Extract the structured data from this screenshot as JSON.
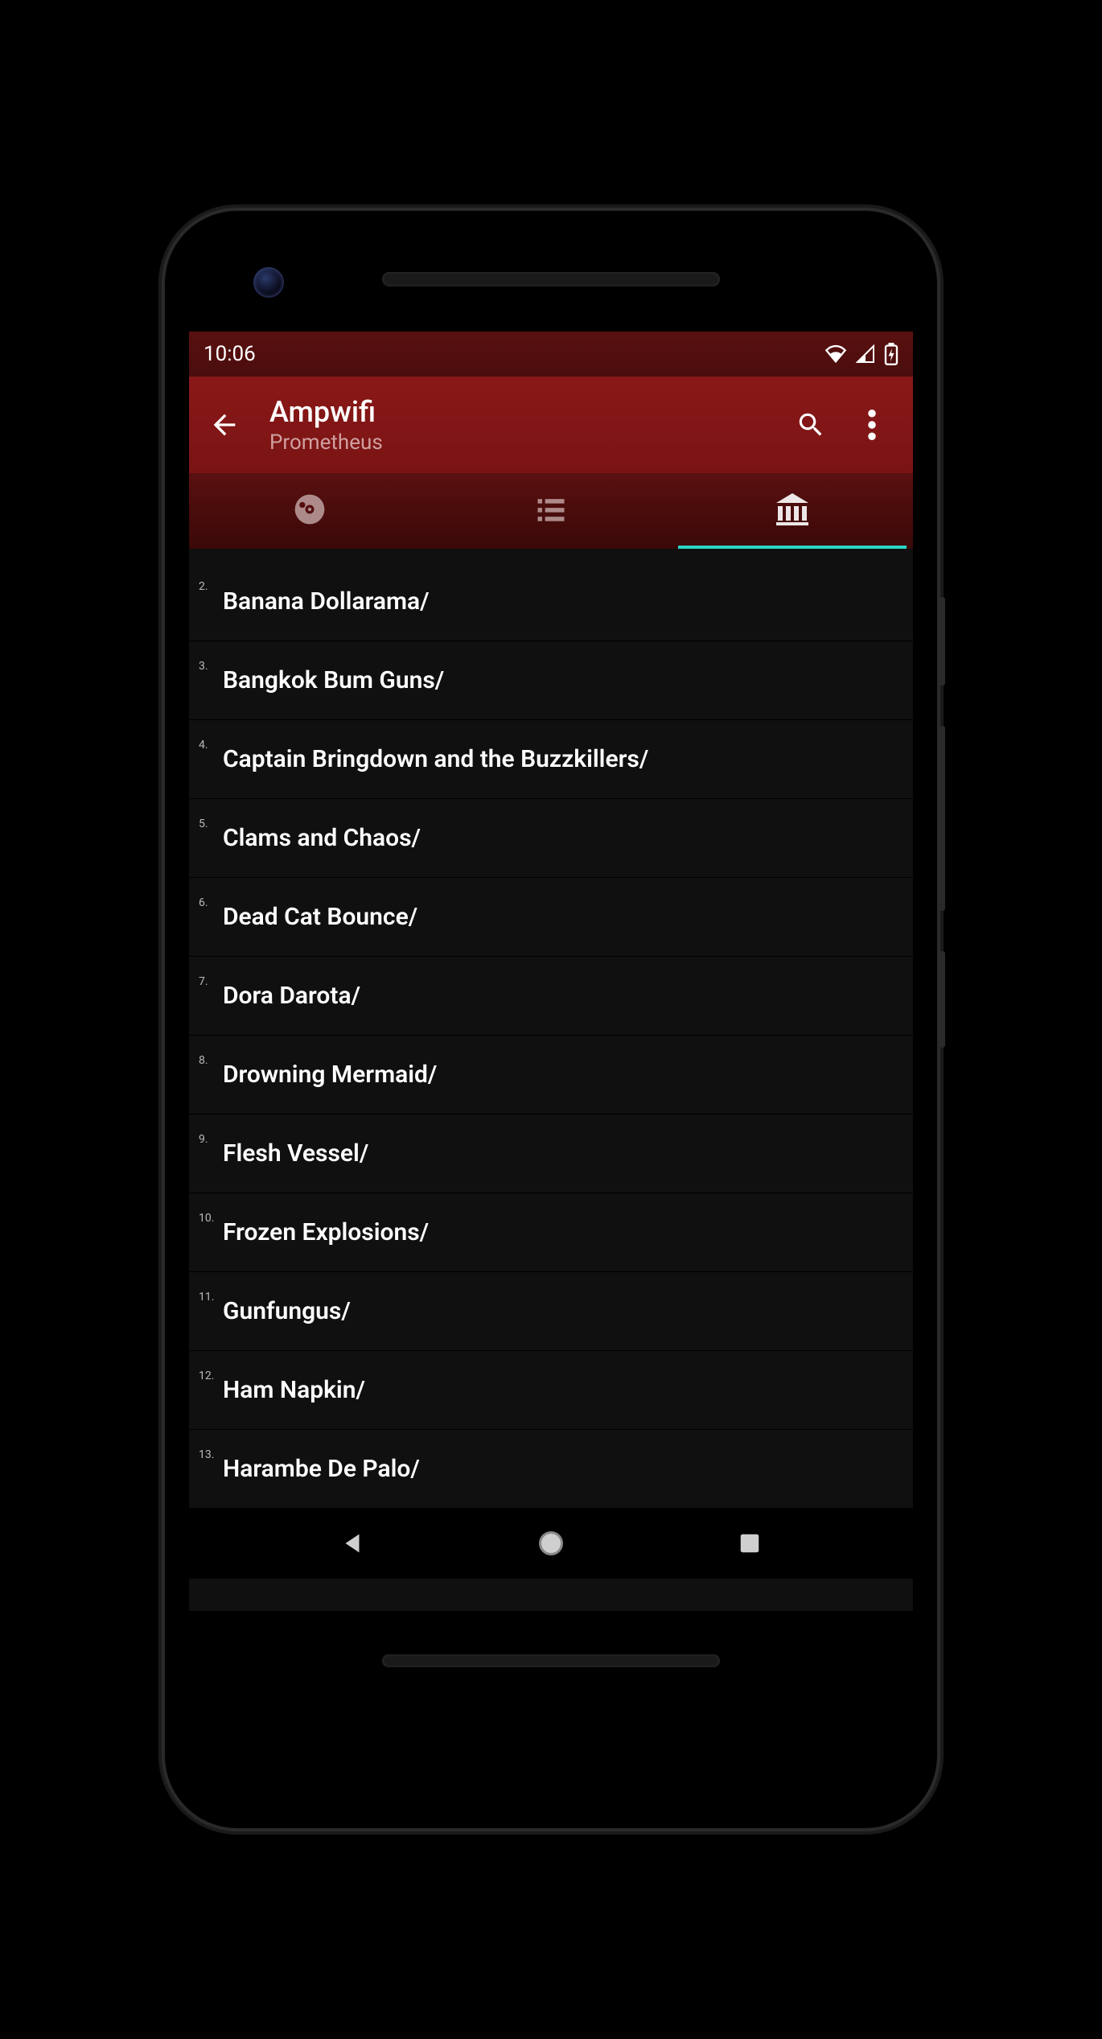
{
  "status": {
    "time": "10:06"
  },
  "header": {
    "title": "Ampwifi",
    "subtitle": "Prometheus"
  },
  "tabs": {
    "active_index": 2,
    "icons": [
      "disc-icon",
      "list-icon",
      "library-icon"
    ]
  },
  "list": {
    "items": [
      {
        "index": "2.",
        "label": "Banana Dollarama/"
      },
      {
        "index": "3.",
        "label": "Bangkok Bum Guns/"
      },
      {
        "index": "4.",
        "label": "Captain Bringdown and the Buzzkillers/"
      },
      {
        "index": "5.",
        "label": "Clams and Chaos/"
      },
      {
        "index": "6.",
        "label": "Dead Cat Bounce/"
      },
      {
        "index": "7.",
        "label": "Dora Darota/"
      },
      {
        "index": "8.",
        "label": "Drowning Mermaid/"
      },
      {
        "index": "9.",
        "label": "Flesh Vessel/"
      },
      {
        "index": "10.",
        "label": "Frozen Explosions/"
      },
      {
        "index": "11.",
        "label": "Gunfungus/"
      },
      {
        "index": "12.",
        "label": "Ham Napkin/"
      },
      {
        "index": "13.",
        "label": "Harambe De Palo/"
      }
    ]
  },
  "colors": {
    "accent": "#2ad4c4",
    "brand_primary": "#7a1414"
  }
}
